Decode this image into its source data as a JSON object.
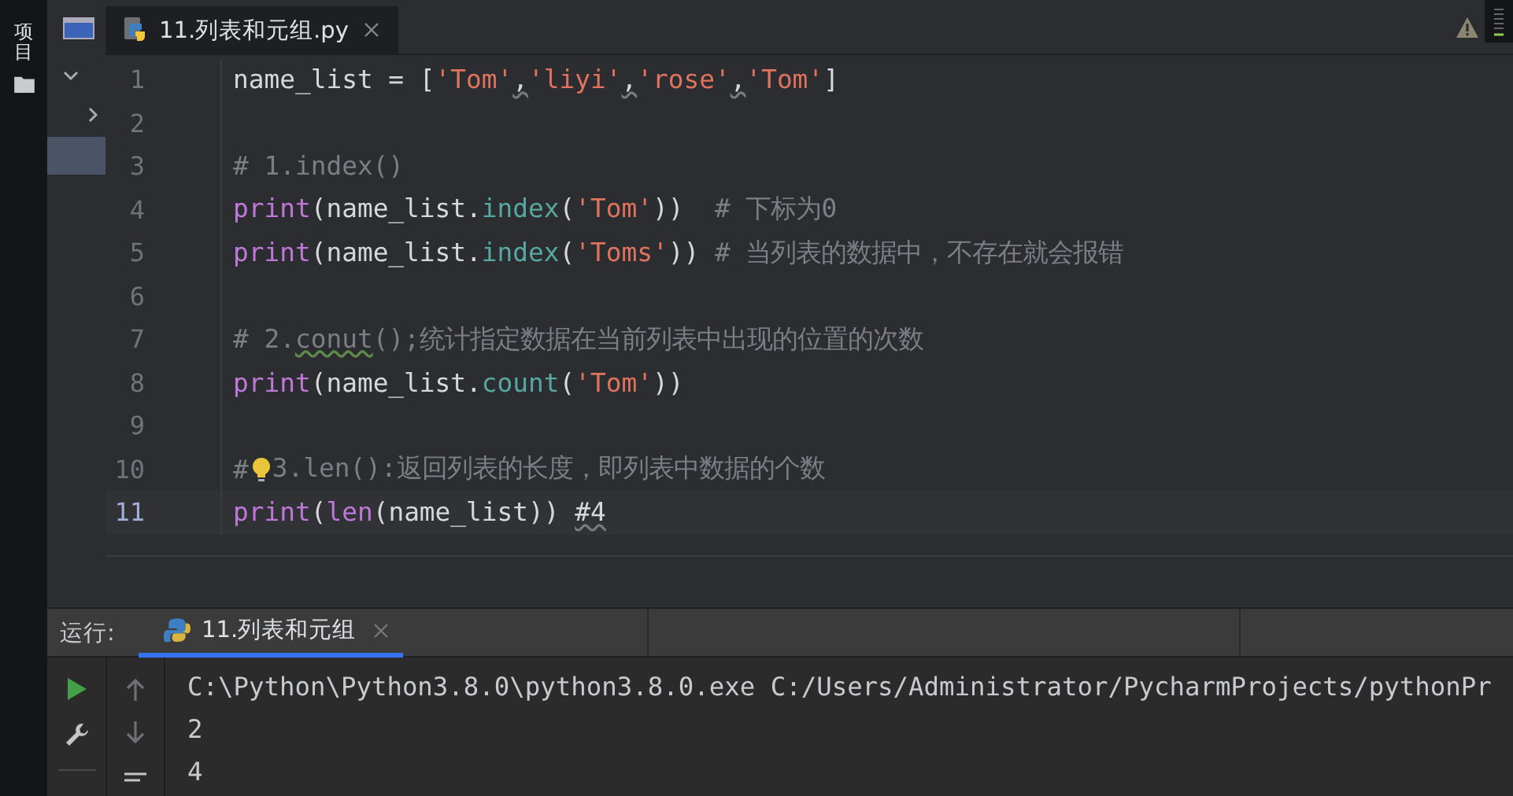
{
  "tool_stripe": {
    "label": "项目"
  },
  "editor_tab": {
    "title": "11.列表和元组.py",
    "selected": true
  },
  "code_lines": [
    {
      "number": "1",
      "current": false,
      "hint": false,
      "tokens": [
        {
          "kind": "plain",
          "text": "name_list = ["
        },
        {
          "kind": "str",
          "text": "'Tom'"
        },
        {
          "kind": "weak",
          "text": ","
        },
        {
          "kind": "str",
          "text": "'liyi'"
        },
        {
          "kind": "weak",
          "text": ","
        },
        {
          "kind": "str",
          "text": "'rose'"
        },
        {
          "kind": "weak",
          "text": ","
        },
        {
          "kind": "str",
          "text": "'Tom'"
        },
        {
          "kind": "plain",
          "text": "]"
        }
      ]
    },
    {
      "number": "2",
      "current": false,
      "hint": false
    },
    {
      "number": "3",
      "current": false,
      "hint": false,
      "tokens": [
        {
          "kind": "comment",
          "text": "# 1.index()"
        }
      ]
    },
    {
      "number": "4",
      "current": false,
      "hint": false,
      "tokens": [
        {
          "kind": "kw",
          "text": "print"
        },
        {
          "kind": "plain",
          "text": "(name_list."
        },
        {
          "kind": "fn",
          "text": "index"
        },
        {
          "kind": "plain",
          "text": "("
        },
        {
          "kind": "str",
          "text": "'Tom'"
        },
        {
          "kind": "plain",
          "text": "))  "
        },
        {
          "kind": "comment",
          "text": "# 下标为0"
        }
      ]
    },
    {
      "number": "5",
      "current": false,
      "hint": false,
      "tokens": [
        {
          "kind": "kw",
          "text": "print"
        },
        {
          "kind": "plain",
          "text": "(name_list."
        },
        {
          "kind": "fn",
          "text": "index"
        },
        {
          "kind": "plain",
          "text": "("
        },
        {
          "kind": "str",
          "text": "'Toms'"
        },
        {
          "kind": "plain",
          "text": ")) "
        },
        {
          "kind": "comment",
          "text": "# 当列表的数据中，不存在就会报错"
        }
      ]
    },
    {
      "number": "6",
      "current": false,
      "hint": false
    },
    {
      "number": "7",
      "current": false,
      "hint": false,
      "tokens": [
        {
          "kind": "comment",
          "text": "# 2."
        },
        {
          "kind": "typo",
          "text": "conut"
        },
        {
          "kind": "comment",
          "text": "();统计指定数据在当前列表中出现的位置的次数"
        }
      ]
    },
    {
      "number": "8",
      "current": false,
      "hint": false,
      "tokens": [
        {
          "kind": "kw",
          "text": "print"
        },
        {
          "kind": "plain",
          "text": "(name_list."
        },
        {
          "kind": "fn",
          "text": "count"
        },
        {
          "kind": "plain",
          "text": "("
        },
        {
          "kind": "str",
          "text": "'Tom'"
        },
        {
          "kind": "plain",
          "text": "))"
        }
      ]
    },
    {
      "number": "9",
      "current": false,
      "hint": false
    },
    {
      "number": "10",
      "current": false,
      "hint": true,
      "tokens": [
        {
          "kind": "comment",
          "text": "#"
        }
      ],
      "after_hint": [
        {
          "kind": "comment",
          "text": "3.len():返回列表的长度，即列表中数据的个数"
        }
      ]
    },
    {
      "number": "11",
      "current": true,
      "hint": false,
      "tokens": [
        {
          "kind": "kw",
          "text": "print"
        },
        {
          "kind": "plain",
          "text": "("
        },
        {
          "kind": "kw",
          "text": "len"
        },
        {
          "kind": "plain",
          "text": "(name_list)) "
        },
        {
          "kind": "weak",
          "text": "#4"
        }
      ]
    }
  ],
  "run_panel": {
    "label": "运行:",
    "tab": {
      "title": "11.列表和元组",
      "selected": true
    }
  },
  "console_lines": [
    "C:\\Python\\Python3.8.0\\python3.8.0.exe C:/Users/Administrator/PycharmProjects/pythonPr",
    "2",
    "4"
  ]
}
